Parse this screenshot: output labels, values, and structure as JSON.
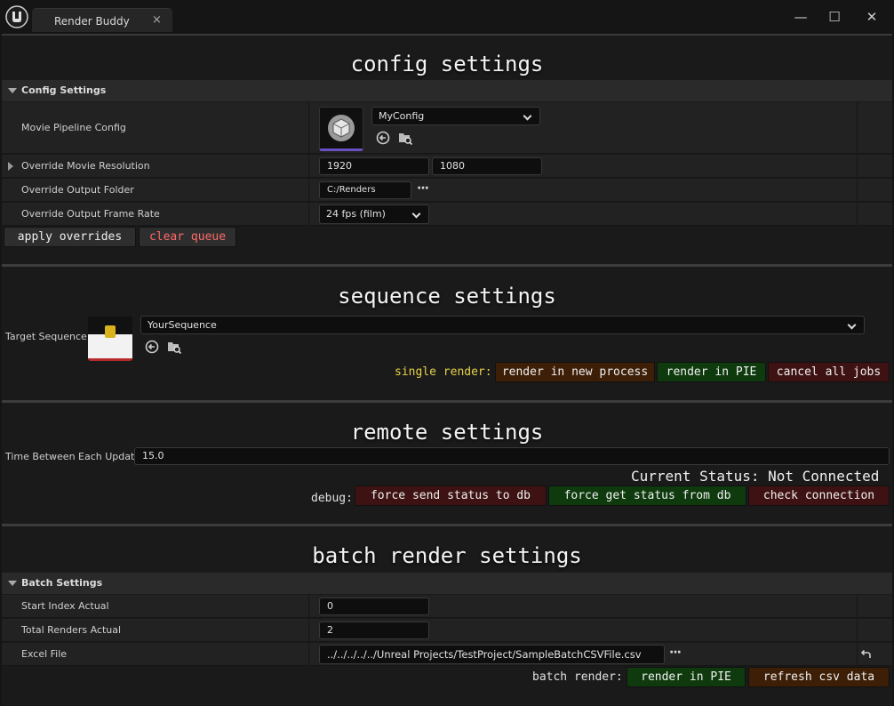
{
  "window": {
    "tab_title": "Render Buddy",
    "tab_close": "×",
    "minimize": "—",
    "maximize": "☐",
    "close": "✕"
  },
  "config": {
    "title": "config settings",
    "category": "Config Settings",
    "movie_pipeline_label": "Movie Pipeline Config",
    "movie_pipeline_value": "MyConfig",
    "resolution_label": "Override Movie Resolution",
    "resolution_width": "1920",
    "resolution_height": "1080",
    "output_folder_label": "Override Output Folder",
    "output_folder_value": "C:/Renders",
    "frame_rate_label": "Override Output Frame Rate",
    "frame_rate_value": "24 fps (film)",
    "apply_button": "apply overrides",
    "clear_button": "clear queue"
  },
  "sequence": {
    "title": "sequence settings",
    "target_label": "Target Sequence",
    "target_value": "YourSequence",
    "single_render_label": "single render:",
    "render_new_process": "render in new process",
    "render_pie": "render in PIE",
    "cancel_jobs": "cancel all jobs"
  },
  "remote": {
    "title": "remote settings",
    "time_label": "Time Between Each Update",
    "time_value": "15.0",
    "status_text": "Current Status: Not Connected",
    "debug_label": "debug:",
    "force_send": "force send status to db",
    "force_get": "force get status from db",
    "check_connection": "check connection"
  },
  "batch": {
    "title": "batch render settings",
    "category": "Batch Settings",
    "start_index_label": "Start Index Actual",
    "start_index_value": "0",
    "total_renders_label": "Total Renders Actual",
    "total_renders_value": "2",
    "excel_label": "Excel File",
    "excel_value": "../../../../../Unreal Projects/TestProject/SampleBatchCSVFile.csv",
    "batch_render_label": "batch render:",
    "render_pie": "render in PIE",
    "refresh_csv": "refresh csv data"
  },
  "colors": {
    "yellow_label": "#e6d24a",
    "red_text": "#ff6a6a",
    "brown_button": "#3d1e06",
    "green_button": "#0e3a0e",
    "maroon_button": "#3e1212"
  }
}
